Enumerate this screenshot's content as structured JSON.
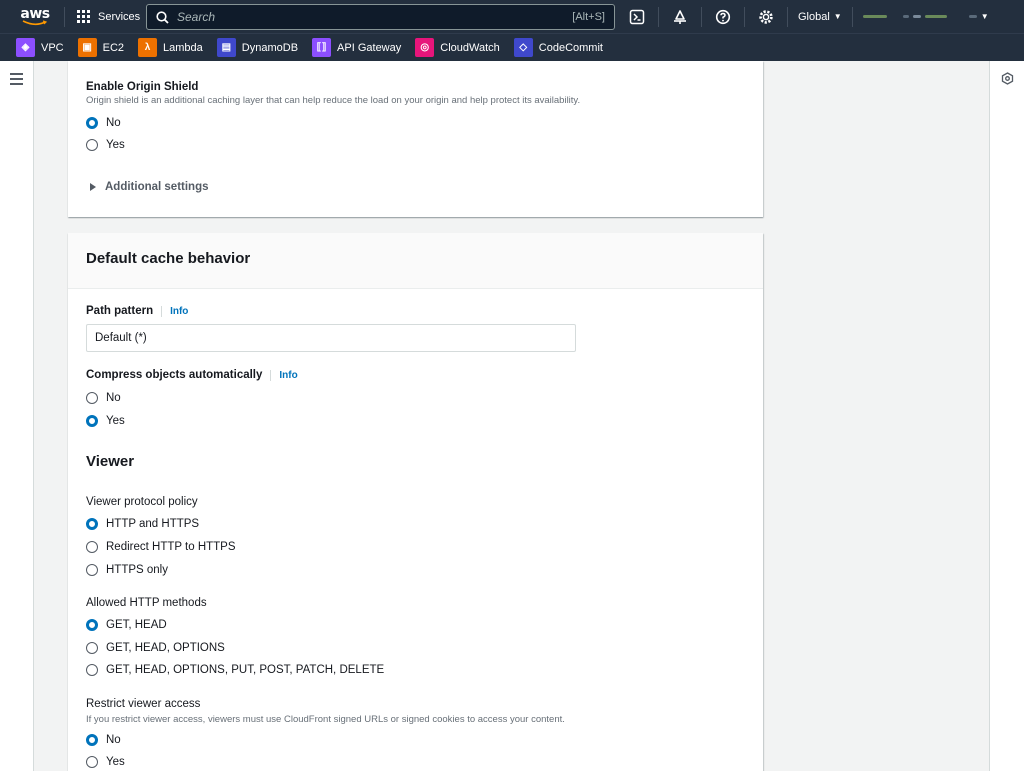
{
  "nav": {
    "logo": "aws",
    "services": "Services",
    "search_placeholder": "Search",
    "search_shortcut": "[Alt+S]",
    "region": "Global",
    "icons": [
      "cloudshell-icon",
      "notifications-icon",
      "help-icon",
      "settings-icon"
    ]
  },
  "favorites": [
    {
      "label": "VPC",
      "color": "#8c4fff"
    },
    {
      "label": "EC2",
      "color": "#ed7100"
    },
    {
      "label": "Lambda",
      "color": "#ed7100"
    },
    {
      "label": "DynamoDB",
      "color": "#3f48cc"
    },
    {
      "label": "API Gateway",
      "color": "#8c4fff"
    },
    {
      "label": "CloudWatch",
      "color": "#e7157b"
    },
    {
      "label": "CodeCommit",
      "color": "#3f48cc"
    }
  ],
  "origin_shield": {
    "label": "Enable Origin Shield",
    "description": "Origin shield is an additional caching layer that can help reduce the load on your origin and help protect its availability.",
    "options": [
      "No",
      "Yes"
    ],
    "selected": "No",
    "additional_settings": "Additional settings"
  },
  "cache_behavior": {
    "title": "Default cache behavior",
    "path_pattern": {
      "label": "Path pattern",
      "info": "Info",
      "value": "Default (*)"
    },
    "compress": {
      "label": "Compress objects automatically",
      "info": "Info",
      "options": [
        "No",
        "Yes"
      ],
      "selected": "Yes"
    },
    "viewer": {
      "title": "Viewer",
      "protocol": {
        "label": "Viewer protocol policy",
        "options": [
          "HTTP and HTTPS",
          "Redirect HTTP to HTTPS",
          "HTTPS only"
        ],
        "selected": "HTTP and HTTPS"
      },
      "methods": {
        "label": "Allowed HTTP methods",
        "options": [
          "GET, HEAD",
          "GET, HEAD, OPTIONS",
          "GET, HEAD, OPTIONS, PUT, POST, PATCH, DELETE"
        ],
        "selected": "GET, HEAD"
      },
      "restrict": {
        "label": "Restrict viewer access",
        "description": "If you restrict viewer access, viewers must use CloudFront signed URLs or signed cookies to access your content.",
        "options": [
          "No",
          "Yes"
        ],
        "selected": "No"
      }
    }
  }
}
